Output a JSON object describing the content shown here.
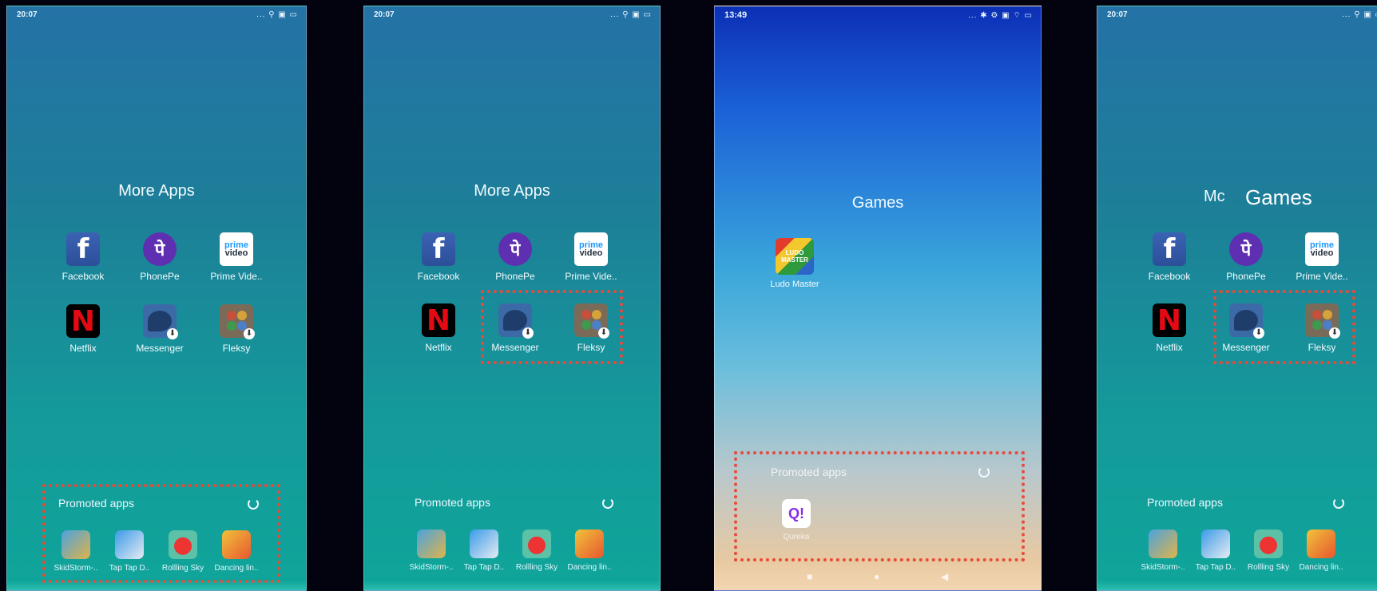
{
  "screens": [
    {
      "time": "20:07",
      "system_icons": "... ⚲ ▣ ▭",
      "folder_title": "More Apps",
      "apps": [
        "Facebook",
        "PhonePe",
        "Prime Vide..",
        "Netflix",
        "Messenger",
        "Fleksy"
      ],
      "promoted_title": "Promoted apps",
      "promoted_apps": [
        "SkidStorm-..",
        "Tap Tap D..",
        "Rollling Sky",
        "Dancing lin.."
      ]
    },
    {
      "time": "20:07",
      "system_icons": "... ⚲ ▣ ▭",
      "folder_title": "More Apps",
      "apps": [
        "Facebook",
        "PhonePe",
        "Prime Vide..",
        "Netflix",
        "Messenger",
        "Fleksy"
      ],
      "promoted_title": "Promoted apps",
      "promoted_apps": [
        "SkidStorm-..",
        "Tap Tap D..",
        "Rollling Sky",
        "Dancing lin.."
      ]
    },
    {
      "time": "13:49",
      "system_icons": "... ✱ ⚙ ▣ ⌔ ▭",
      "folder_title": "Games",
      "game_app": "Ludo Master",
      "game_icon_text": "LUDO MASTER",
      "promoted_title": "Promoted apps",
      "promoted_app": "Qureka",
      "promoted_icon_text": "Q!",
      "nav_keys": [
        "■",
        "●",
        "◀"
      ]
    },
    {
      "time": "20:07",
      "system_icons": "... ⚲ ▣ ▭",
      "folder_title": "Mc",
      "overlay_title": "Games",
      "apps": [
        "Facebook",
        "PhonePe",
        "Prime Vide..",
        "Netflix",
        "Messenger",
        "Fleksy"
      ],
      "promoted_title": "Promoted apps",
      "promoted_apps": [
        "SkidStorm-..",
        "Tap Tap D..",
        "Rollling Sky",
        "Dancing lin.."
      ]
    }
  ],
  "icons": {
    "facebook": "f",
    "phonepe": "पे",
    "prime": [
      "prime",
      "video"
    ],
    "netflix": "N",
    "download_badge": "⬇"
  },
  "colors": {
    "highlight": "#e84a3a",
    "teal": "#149a9a"
  }
}
